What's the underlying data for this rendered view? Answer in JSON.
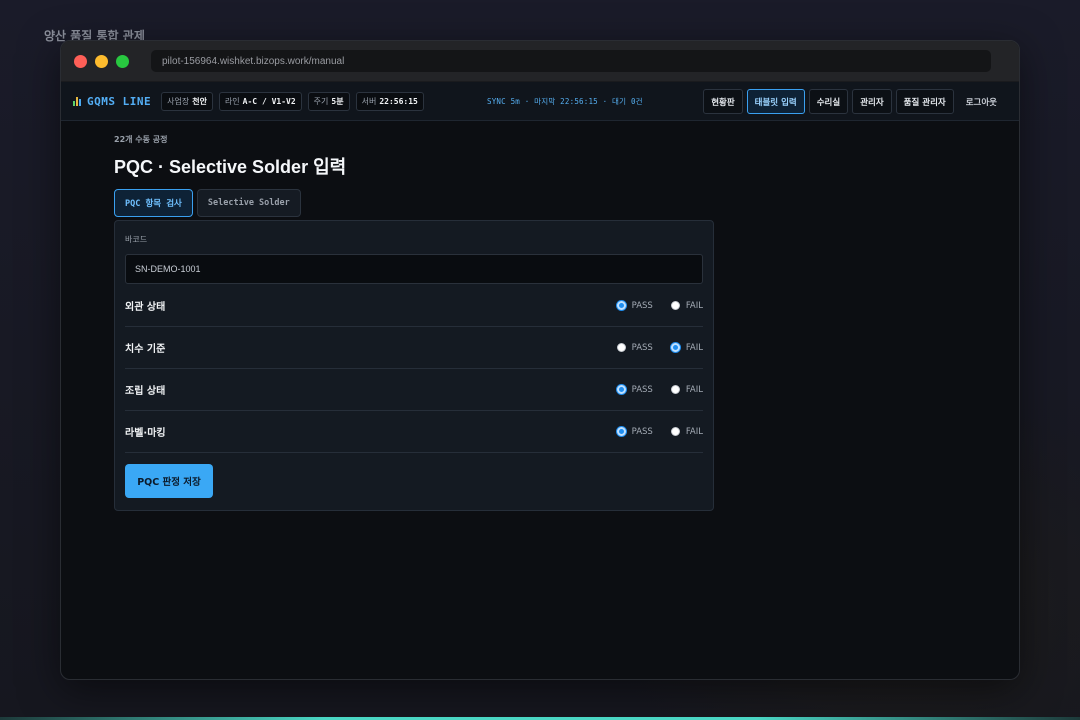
{
  "page_caption": "양산 품질 통합 관제",
  "browser": {
    "url": "pilot-156964.wishket.bizops.work/manual"
  },
  "header": {
    "logo": "GQMS LINE",
    "chips": [
      {
        "label": "사업장",
        "value": "천안"
      },
      {
        "label": "라인",
        "value": "A-C / V1-V2"
      },
      {
        "label": "주기",
        "value": "5분"
      },
      {
        "label": "서버",
        "value": "22:56:15"
      }
    ],
    "sync": "SYNC 5m · 마지막 22:56:15 · 대기 0건",
    "nav": [
      "현황판",
      "태블릿 입력",
      "수리실",
      "관리자",
      "품질 관리자",
      "로그아웃"
    ],
    "nav_active": "태블릿 입력"
  },
  "main": {
    "section_label": "22개 수동 공정",
    "title": "PQC · Selective Solder 입력",
    "tabs": [
      "PQC 항목 검사",
      "Selective Solder"
    ],
    "active_tab": "PQC 항목 검사",
    "barcode_label": "바코드",
    "barcode_value": "SN-DEMO-1001",
    "pass_label": "PASS",
    "fail_label": "FAIL",
    "checks": [
      {
        "label": "외관 상태",
        "selected": "PASS"
      },
      {
        "label": "치수 기준",
        "selected": "FAIL"
      },
      {
        "label": "조립 상태",
        "selected": "PASS"
      },
      {
        "label": "라벨·마킹",
        "selected": "PASS"
      }
    ],
    "save_label": "PQC 판정 저장"
  },
  "colors": {
    "accent": "#3aa8f5",
    "background": "#0c0e12",
    "card": "#141a22"
  }
}
